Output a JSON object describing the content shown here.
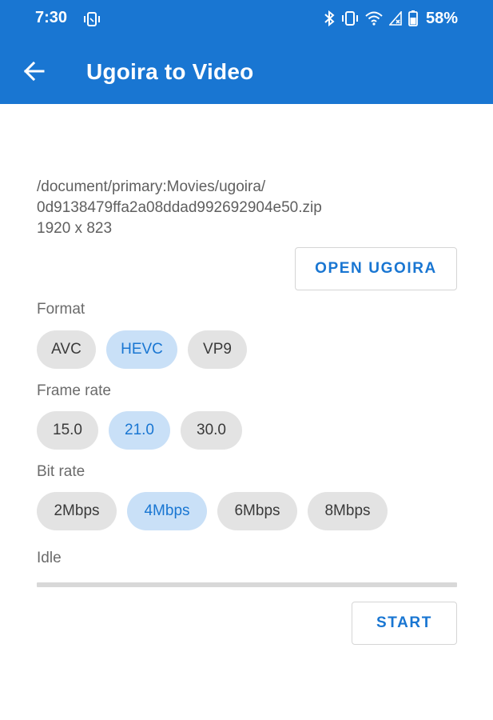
{
  "status_bar": {
    "time": "7:30",
    "battery": "58%"
  },
  "app_bar": {
    "title": "Ugoira to Video"
  },
  "file": {
    "path": "/document/primary:Movies/ugoira/\n0d9138479ffa2a08ddad992692904e50.zip",
    "dimensions": "1920 x 823"
  },
  "open_button": "OPEN UGOIRA",
  "format": {
    "label": "Format",
    "options": [
      "AVC",
      "HEVC",
      "VP9"
    ],
    "selected": "HEVC"
  },
  "frame_rate": {
    "label": "Frame rate",
    "options": [
      "15.0",
      "21.0",
      "30.0"
    ],
    "selected": "21.0"
  },
  "bit_rate": {
    "label": "Bit rate",
    "options": [
      "2Mbps",
      "4Mbps",
      "6Mbps",
      "8Mbps"
    ],
    "selected": "4Mbps"
  },
  "status": {
    "text": "Idle",
    "progress": 0
  },
  "start_button": "START",
  "colors": {
    "primary": "#1976d2",
    "chip_selected_bg": "#c9e0f7",
    "chip_bg": "#e3e3e3"
  }
}
